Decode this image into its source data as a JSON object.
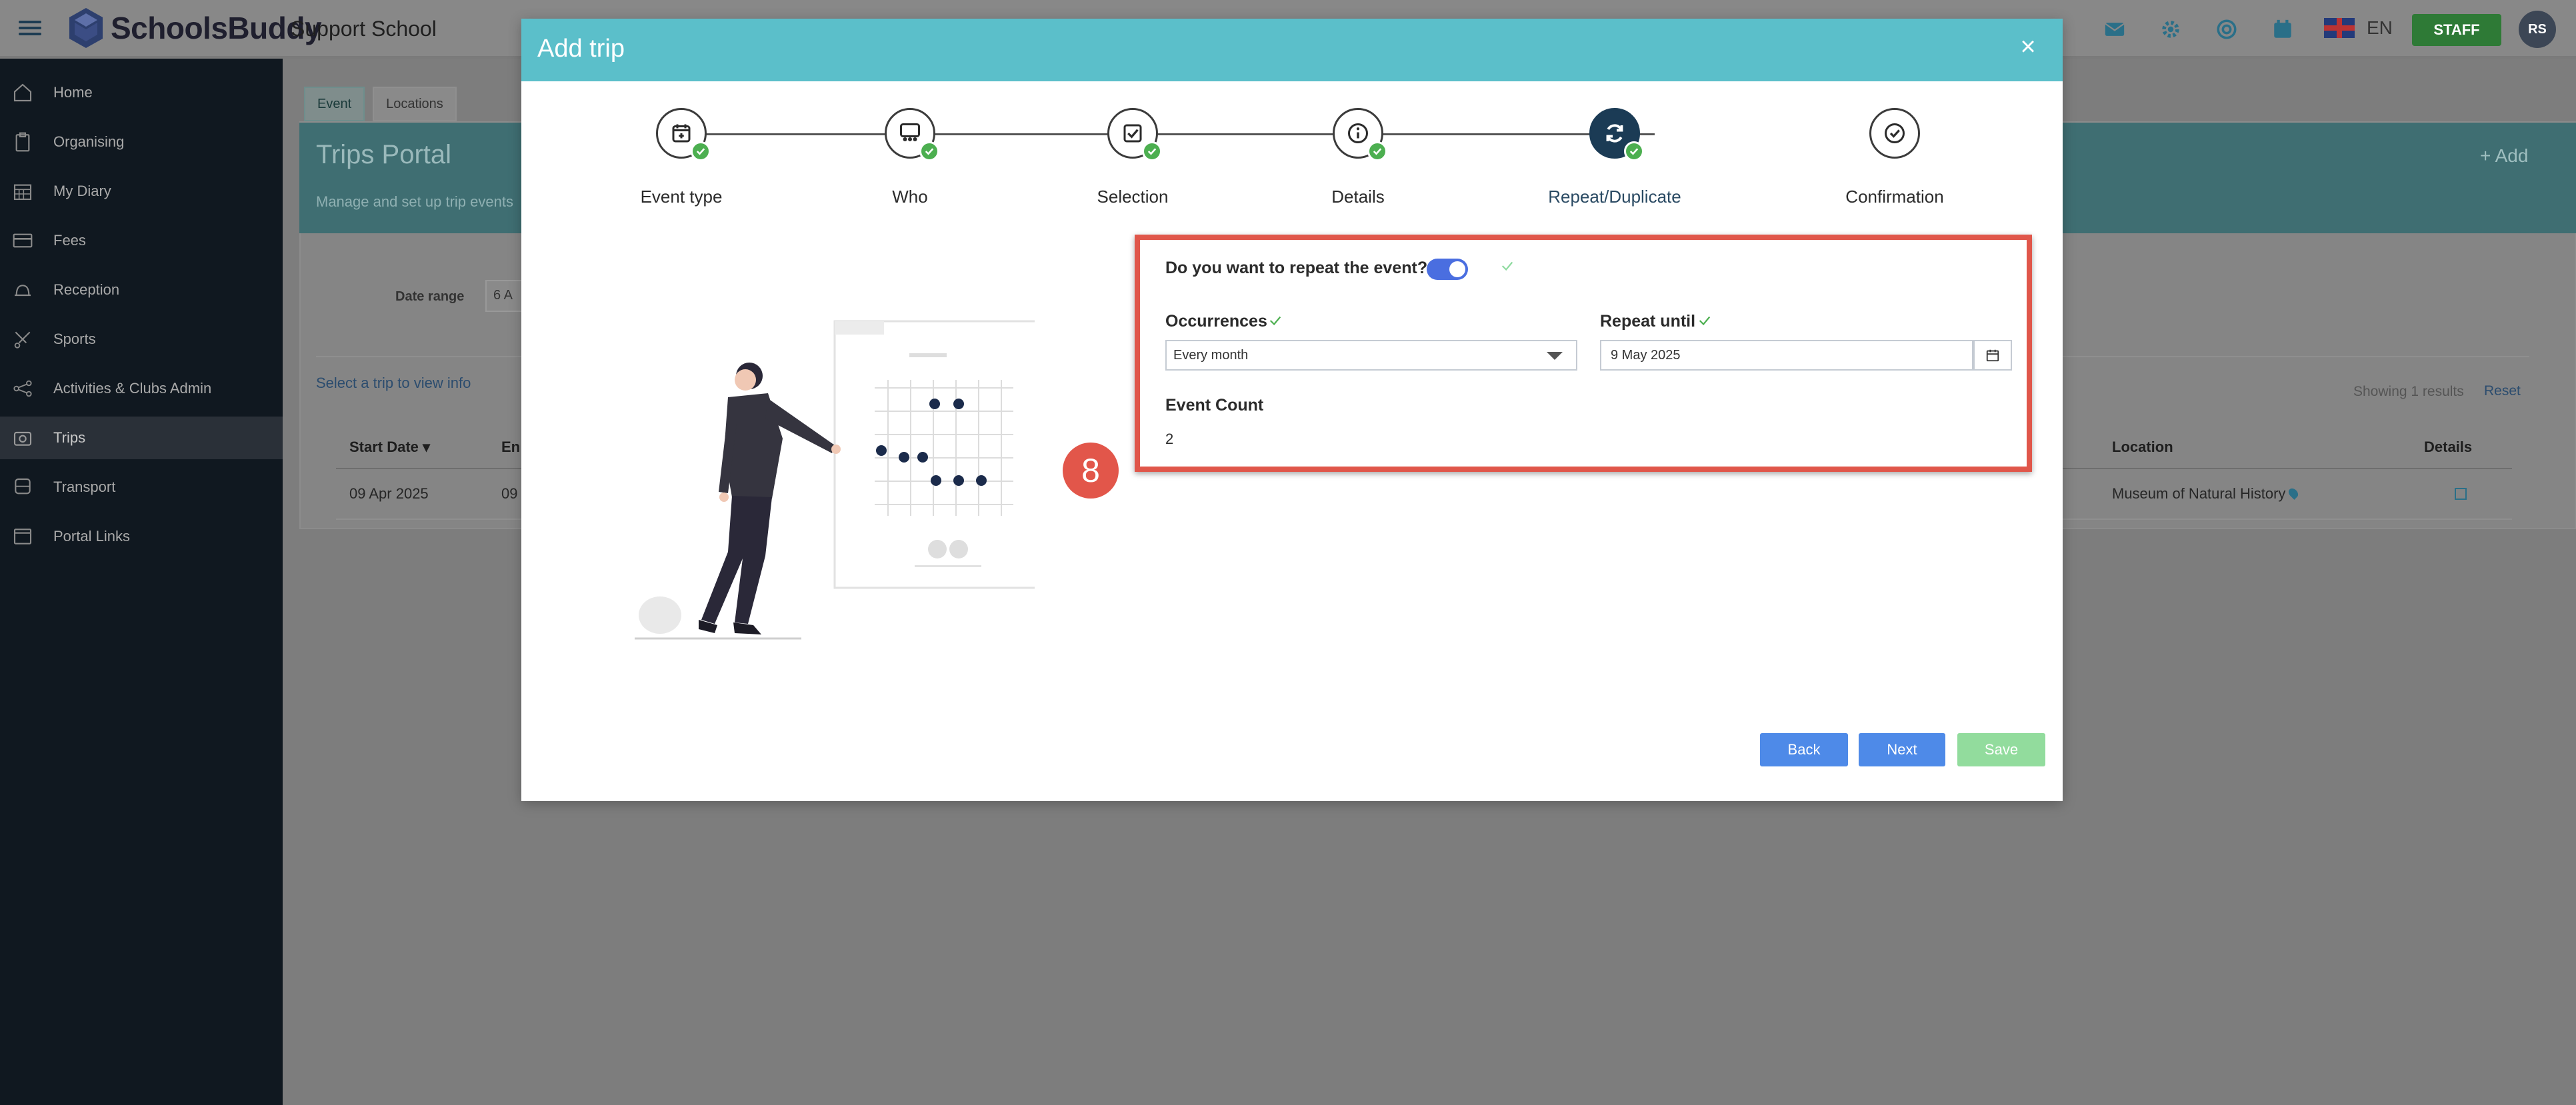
{
  "app": {
    "brand": "SchoolsBuddy",
    "school": "Support School",
    "language": "EN",
    "staff_label": "STAFF",
    "avatar_initials": "RS"
  },
  "sidebar": {
    "items": [
      {
        "label": "Home",
        "icon": "home-icon"
      },
      {
        "label": "Organising",
        "icon": "clipboard-icon"
      },
      {
        "label": "My Diary",
        "icon": "calendar-icon"
      },
      {
        "label": "Fees",
        "icon": "card-icon"
      },
      {
        "label": "Reception",
        "icon": "bell-icon"
      },
      {
        "label": "Sports",
        "icon": "sports-icon"
      },
      {
        "label": "Activities & Clubs Admin",
        "icon": "network-icon"
      },
      {
        "label": "Trips",
        "icon": "trips-icon"
      },
      {
        "label": "Transport",
        "icon": "bus-icon"
      },
      {
        "label": "Portal Links",
        "icon": "window-icon"
      }
    ],
    "active": "Trips"
  },
  "page": {
    "tabs": [
      "Event",
      "Locations"
    ],
    "title": "Trips Portal",
    "subtitle": "Manage and set up trip events",
    "add_label": "+ Add",
    "date_range_label": "Date range",
    "date_range_value": "6 A",
    "select_hint": "Select a trip to view info",
    "showing": "Showing 1 results",
    "reset": "Reset",
    "columns": {
      "start": "Start Date",
      "end": "En",
      "location": "Location",
      "details": "Details"
    },
    "row": {
      "start": "09 Apr 2025",
      "end": "09",
      "location": "Museum of Natural History"
    }
  },
  "modal": {
    "title": "Add trip",
    "steps": [
      {
        "label": "Event type",
        "icon": "calendar-plus-icon",
        "done": true
      },
      {
        "label": "Who",
        "icon": "group-icon",
        "done": true
      },
      {
        "label": "Selection",
        "icon": "checkbox-icon",
        "done": true
      },
      {
        "label": "Details",
        "icon": "info-icon",
        "done": true
      },
      {
        "label": "Repeat/Duplicate",
        "icon": "refresh-icon",
        "done": true,
        "current": true
      },
      {
        "label": "Confirmation",
        "icon": "check-circle-icon",
        "done": false
      }
    ],
    "annotation_number": "8",
    "repeat_question": "Do you want to repeat the event?",
    "repeat_enabled": true,
    "occurrences_label": "Occurrences",
    "occurrences_value": "Every month",
    "repeat_until_label": "Repeat until",
    "repeat_until_value": "9 May 2025",
    "event_count_label": "Event Count",
    "event_count_value": "2",
    "buttons": {
      "back": "Back",
      "next": "Next",
      "save": "Save"
    }
  },
  "colors": {
    "modal_header": "#5bbfca",
    "primary_button": "#4e8ae8",
    "save_button": "#92dc9d",
    "highlight_border": "#e0564a",
    "step_done": "#4caf50",
    "step_current": "#1b3b55"
  }
}
